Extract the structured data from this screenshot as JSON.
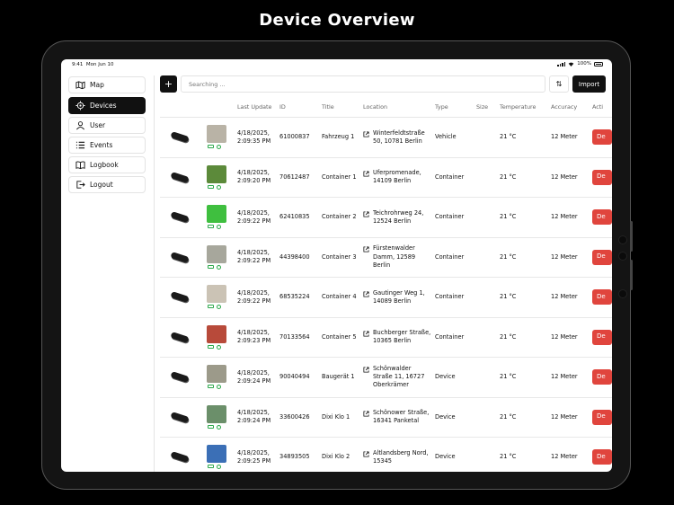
{
  "headline": "Device Overview",
  "status_bar": {
    "time": "9:41",
    "date": "Mon Jun 10",
    "battery": "100%"
  },
  "sidebar": {
    "items": [
      {
        "label": "Map",
        "icon": "map-icon",
        "active": false
      },
      {
        "label": "Devices",
        "icon": "target-icon",
        "active": true
      },
      {
        "label": "User",
        "icon": "user-icon",
        "active": false
      },
      {
        "label": "Events",
        "icon": "list-icon",
        "active": false
      },
      {
        "label": "Logbook",
        "icon": "book-icon",
        "active": false
      },
      {
        "label": "Logout",
        "icon": "logout-icon",
        "active": false
      }
    ]
  },
  "toolbar": {
    "add_label": "+",
    "search_placeholder": "Searching ...",
    "sort_label": "⇅",
    "import_label": "Import"
  },
  "table": {
    "headers": [
      "",
      "",
      "Last Update",
      "ID",
      "Title",
      "Location",
      "Type",
      "Size",
      "Temperature",
      "Accuracy",
      "Acti"
    ],
    "delete_label": "De",
    "rows": [
      {
        "last_update": "4/18/2025, 2:09:35 PM",
        "id": "61000837",
        "title": "Fahrzeug 1",
        "location": "Winterfeldtstraße 50, 10781 Berlin",
        "type": "Vehicle",
        "size": "",
        "temperature": "21 °C",
        "accuracy": "12 Meter",
        "thumb_color": "#b9b3a6"
      },
      {
        "last_update": "4/18/2025, 2:09:20 PM",
        "id": "70612487",
        "title": "Container 1",
        "location": "Uferpromenade, 14109 Berlin",
        "type": "Container",
        "size": "",
        "temperature": "21 °C",
        "accuracy": "12 Meter",
        "thumb_color": "#5c8a3a"
      },
      {
        "last_update": "4/18/2025, 2:09:22 PM",
        "id": "62410835",
        "title": "Container 2",
        "location": "Teichrohrweg 24, 12524 Berlin",
        "type": "Container",
        "size": "",
        "temperature": "21 °C",
        "accuracy": "12 Meter",
        "thumb_color": "#3fbf3f"
      },
      {
        "last_update": "4/18/2025, 2:09:22 PM",
        "id": "44398400",
        "title": "Container 3",
        "location": "Fürstenwalder Damm, 12589 Berlin",
        "type": "Container",
        "size": "",
        "temperature": "21 °C",
        "accuracy": "12 Meter",
        "thumb_color": "#a7a79c"
      },
      {
        "last_update": "4/18/2025, 2:09:22 PM",
        "id": "68535224",
        "title": "Container 4",
        "location": "Gautinger Weg 1, 14089 Berlin",
        "type": "Container",
        "size": "",
        "temperature": "21 °C",
        "accuracy": "12 Meter",
        "thumb_color": "#cbc3b5"
      },
      {
        "last_update": "4/18/2025, 2:09:23 PM",
        "id": "70133564",
        "title": "Container 5",
        "location": "Buchberger Straße, 10365 Berlin",
        "type": "Container",
        "size": "",
        "temperature": "21 °C",
        "accuracy": "12 Meter",
        "thumb_color": "#b84a3a"
      },
      {
        "last_update": "4/18/2025, 2:09:24 PM",
        "id": "90040494",
        "title": "Baugerät 1",
        "location": "Schönwalder Straße 11, 16727 Oberkrämer",
        "type": "Device",
        "size": "",
        "temperature": "21 °C",
        "accuracy": "12 Meter",
        "thumb_color": "#9c9a8a"
      },
      {
        "last_update": "4/18/2025, 2:09:24 PM",
        "id": "33600426",
        "title": "Dixi Klo 1",
        "location": "Schönower Straße, 16341 Panketal",
        "type": "Device",
        "size": "",
        "temperature": "21 °C",
        "accuracy": "12 Meter",
        "thumb_color": "#6b8f6a"
      },
      {
        "last_update": "4/18/2025, 2:09:25 PM",
        "id": "34893505",
        "title": "Dixi Klo 2",
        "location": "Altlandsberg Nord, 15345",
        "type": "Device",
        "size": "",
        "temperature": "21 °C",
        "accuracy": "12 Meter",
        "thumb_color": "#3b6fb6"
      }
    ]
  },
  "colors": {
    "accent": "#111111",
    "delete": "#e0453d",
    "status_ok": "#2aa84a"
  }
}
